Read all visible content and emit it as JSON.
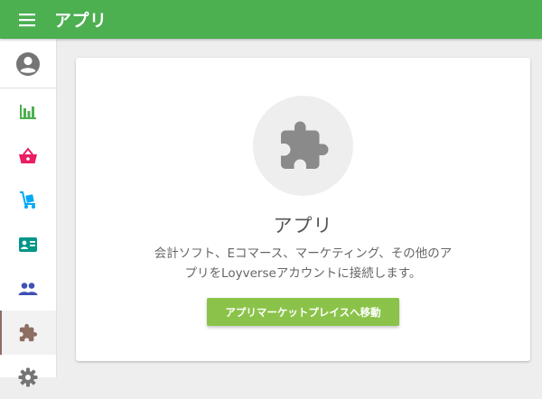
{
  "header": {
    "title": "アプリ",
    "menu_icon": "hamburger-menu-icon"
  },
  "sidebar": {
    "items": [
      {
        "name": "account",
        "icon": "account-circle-icon",
        "color": "#757575"
      },
      {
        "name": "reports",
        "icon": "bar-chart-icon",
        "color": "#4caf50"
      },
      {
        "name": "sales",
        "icon": "shopping-basket-icon",
        "color": "#e91e63"
      },
      {
        "name": "inventory",
        "icon": "hand-truck-icon",
        "color": "#03a9f4"
      },
      {
        "name": "employees",
        "icon": "id-card-icon",
        "color": "#009688"
      },
      {
        "name": "customers",
        "icon": "people-icon",
        "color": "#3f51b5"
      },
      {
        "name": "apps",
        "icon": "puzzle-piece-icon",
        "color": "#8d6e63",
        "active": true
      },
      {
        "name": "settings",
        "icon": "gear-icon",
        "color": "#757575"
      }
    ]
  },
  "main": {
    "icon": "puzzle-piece-icon",
    "title": "アプリ",
    "description_line1": "会計ソフト、Eコマース、マーケティング、その他のア",
    "description_line2": "プリをLoyverseアカウントに接続します。",
    "button_label": "アプリマーケットプレイスへ移動"
  },
  "colors": {
    "header": "#4caf50",
    "button": "#8bc34a",
    "active_indicator": "#8d6e63"
  }
}
